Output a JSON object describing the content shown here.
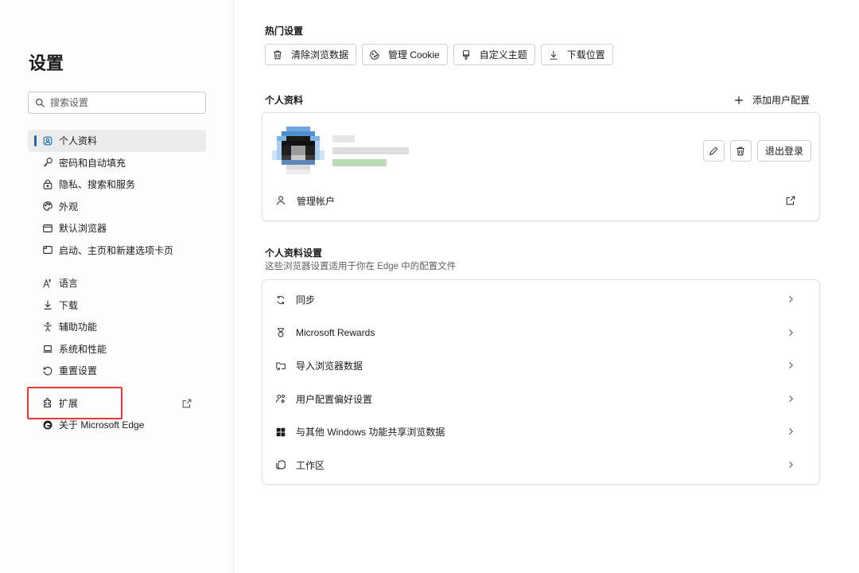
{
  "sidebar": {
    "title": "设置",
    "search_placeholder": "搜索设置",
    "items": [
      {
        "label": "个人资料"
      },
      {
        "label": "密码和自动填充"
      },
      {
        "label": "隐私、搜索和服务"
      },
      {
        "label": "外观"
      },
      {
        "label": "默认浏览器"
      },
      {
        "label": "启动、主页和新建选项卡页"
      },
      {
        "label": "语言"
      },
      {
        "label": "下载"
      },
      {
        "label": "辅助功能"
      },
      {
        "label": "系统和性能"
      },
      {
        "label": "重置设置"
      },
      {
        "label": "扩展"
      },
      {
        "label": "关于 Microsoft Edge"
      }
    ]
  },
  "hot": {
    "title": "热门设置",
    "buttons": [
      {
        "label": "清除浏览数据"
      },
      {
        "label": "管理 Cookie"
      },
      {
        "label": "自定义主题"
      },
      {
        "label": "下载位置"
      }
    ]
  },
  "profile": {
    "title": "个人资料",
    "add_label": "添加用户配置",
    "signout_label": "退出登录",
    "manage_label": "管理帐户"
  },
  "profile_settings": {
    "title": "个人资料设置",
    "description": "这些浏览器设置适用于你在 Edge 中的配置文件",
    "rows": [
      {
        "label": "同步"
      },
      {
        "label": "Microsoft Rewards"
      },
      {
        "label": "导入浏览器数据"
      },
      {
        "label": "用户配置偏好设置"
      },
      {
        "label": "与其他 Windows 功能共享浏览数据"
      },
      {
        "label": "工作区"
      }
    ]
  },
  "colors": {
    "accent": "#0f6cbd",
    "highlight": "#e53935"
  }
}
